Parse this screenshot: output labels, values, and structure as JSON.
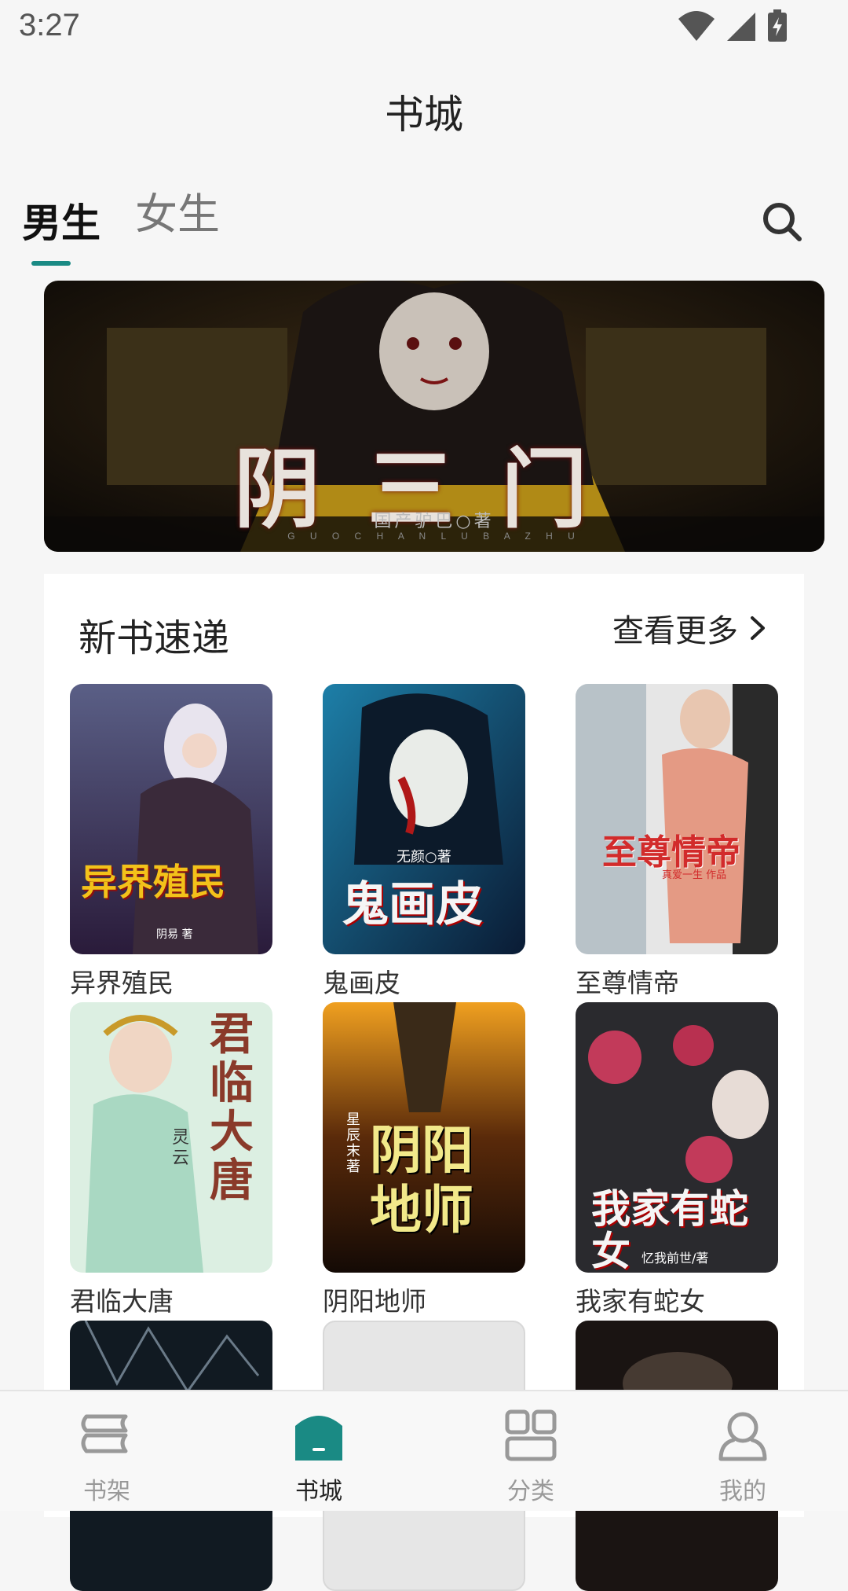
{
  "status_bar": {
    "time": "3:27"
  },
  "header": {
    "title": "书城"
  },
  "tabs": [
    {
      "label": "男生",
      "active": true
    },
    {
      "label": "女生",
      "active": false
    }
  ],
  "banner": {
    "book_title_art": "阴三门",
    "author_art": "国产驴巴○著",
    "author_latin_art": "G U O C H A N L U B A Z H U"
  },
  "section": {
    "title": "新书速递",
    "more_label": "查看更多"
  },
  "books": [
    {
      "title": "异界殖民",
      "cover_text": "异界殖民",
      "cover_author": "阴易 著"
    },
    {
      "title": "鬼画皮",
      "cover_text": "鬼画皮",
      "cover_author": "无颜○著"
    },
    {
      "title": "至尊情帝",
      "cover_text": "至尊情帝",
      "cover_author": "真爱一生 作品"
    },
    {
      "title": "君临大唐",
      "cover_text": "君临大唐",
      "cover_author": "灵云"
    },
    {
      "title": "阴阳地师",
      "cover_text": "阴阳地师",
      "cover_author": "星辰末 著"
    },
    {
      "title": "我家有蛇女",
      "cover_text": "我家有蛇女",
      "cover_author": "忆我前世/著"
    }
  ],
  "bottom_nav": [
    {
      "label": "书架",
      "icon": "bookshelf-icon",
      "active": false
    },
    {
      "label": "书城",
      "icon": "bookstore-icon",
      "active": true
    },
    {
      "label": "分类",
      "icon": "category-grid-icon",
      "active": false
    },
    {
      "label": "我的",
      "icon": "profile-icon",
      "active": false
    }
  ],
  "colors": {
    "accent": "#1a8a84",
    "inactive": "#999999"
  }
}
